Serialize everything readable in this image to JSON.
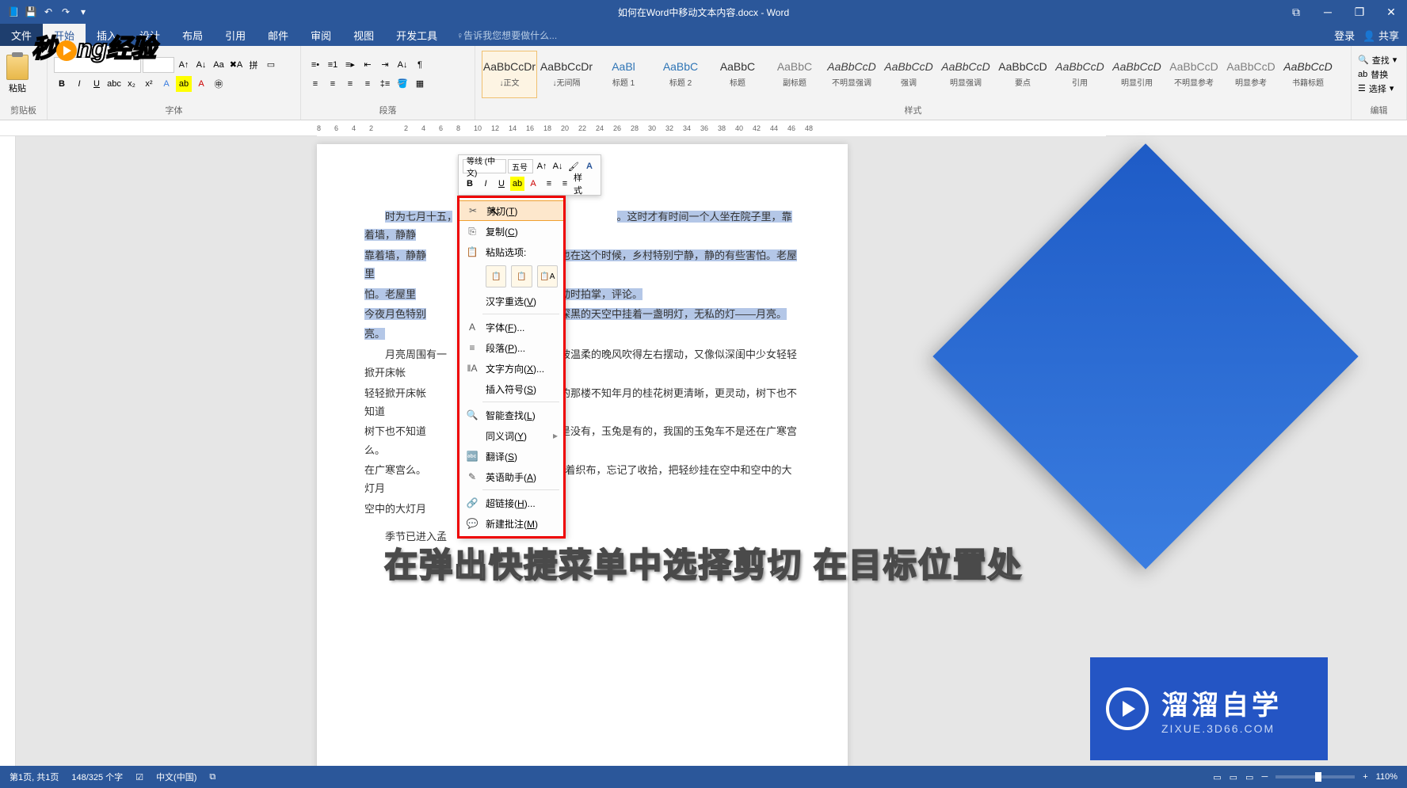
{
  "titlebar": {
    "title": "如何在Word中移动文本内容.docx - Word",
    "ribbon_display": "⧉"
  },
  "tabs": {
    "file": "文件",
    "items": [
      "开始",
      "插入",
      "设计",
      "布局",
      "引用",
      "邮件",
      "审阅",
      "视图",
      "开发工具"
    ],
    "active_index": 0,
    "tellme": "♀告诉我您想要做什么...",
    "login": "登录",
    "share": "共享"
  },
  "ribbon": {
    "clipboard": {
      "paste": "粘贴",
      "label": "剪贴板"
    },
    "font": {
      "label": "字体"
    },
    "paragraph": {
      "label": "段落"
    },
    "styles": {
      "label": "样式",
      "items": [
        {
          "preview": "AaBbCcDr",
          "name": "↓正文",
          "sel": true
        },
        {
          "preview": "AaBbCcDr",
          "name": "↓无间隔"
        },
        {
          "preview": "AaBl",
          "name": "标题 1"
        },
        {
          "preview": "AaBbC",
          "name": "标题 2"
        },
        {
          "preview": "AaBbC",
          "name": "标题"
        },
        {
          "preview": "AaBbC",
          "name": "副标题"
        },
        {
          "preview": "AaBbCcD",
          "name": "不明显强调"
        },
        {
          "preview": "AaBbCcD",
          "name": "强调"
        },
        {
          "preview": "AaBbCcD",
          "name": "明显强调"
        },
        {
          "preview": "AaBbCcD",
          "name": "要点"
        },
        {
          "preview": "AaBbCcD",
          "name": "引用"
        },
        {
          "preview": "AaBbCcD",
          "name": "明显引用"
        },
        {
          "preview": "AaBbCcD",
          "name": "不明显参考"
        },
        {
          "preview": "AaBbCcD",
          "name": "明显参考"
        },
        {
          "preview": "AaBbCcD",
          "name": "书籍标题"
        }
      ]
    },
    "editing": {
      "find": "查找",
      "replace": "替换",
      "select": "选择",
      "label": "编辑"
    }
  },
  "ruler": {
    "marks": [
      "8",
      "6",
      "4",
      "2",
      "",
      "2",
      "4",
      "6",
      "8",
      "10",
      "12",
      "14",
      "16",
      "18",
      "20",
      "22",
      "24",
      "26",
      "28",
      "30",
      "32",
      "34",
      "36",
      "38",
      "40",
      "42",
      "44",
      "46",
      "48"
    ]
  },
  "document": {
    "p1a": "时为七月十五，",
    "p1b": "群山，也在这个时候，乡村特别宁静，静的有些害怕。老屋里",
    "p1c": "偶尔激动时拍掌，评论。",
    "p2a": "今夜月色特别",
    "p2b": "了。深黑的天空中挂着一盏明灯，无私的灯——月亮。",
    "p3a": "月亮周围有一",
    "p3b": "纱被温柔的晚风吹得左右摆动，又像似深闺中少女轻轻掀开床帐",
    "p3c": "亮之上的那楼不知年月的桂花树更清晰，更灵动，树下也不知道",
    "p3d": "。吴刚是没有，玉兔是有的，我国的玉兔车不是还在广寒宫么。",
    "p3e": "女们忙碌着织布，忘记了收拾，把轻纱挂在空中和空中的大灯月",
    "p4": "季节已进入孟",
    "pre": "。这时才有时间一个人坐在院子里，靠着墙，静静"
  },
  "mini_toolbar": {
    "font_name": "等线 (中文)",
    "font_size": "五号",
    "styles_label": "样式"
  },
  "context_menu": {
    "cut": "剪切",
    "cut_key": "T",
    "copy": "复制",
    "copy_key": "C",
    "paste_options": "粘贴选项:",
    "hanzi": "汉字重选",
    "hanzi_key": "V",
    "font": "字体",
    "font_key": "F",
    "paragraph": "段落",
    "paragraph_key": "P",
    "text_dir": "文字方向",
    "text_dir_key": "X",
    "insert_symbol": "插入符号",
    "insert_symbol_key": "S",
    "smart_lookup": "智能查找",
    "smart_lookup_key": "L",
    "synonyms": "同义词",
    "synonyms_key": "Y",
    "translate": "翻译",
    "translate_key": "S",
    "english_assist": "英语助手",
    "english_assist_key": "A",
    "hyperlink": "超链接",
    "hyperlink_key": "H",
    "new_comment": "新建批注",
    "new_comment_key": "M"
  },
  "statusbar": {
    "page": "第1页, 共1页",
    "words": "148/325 个字",
    "lang_icon": "☑",
    "lang": "中文(中国)",
    "track": "⧉",
    "zoom": "110%"
  },
  "overlay": {
    "logo_a": "秒",
    "logo_b": "ng经验",
    "subtitle": "在弹出快捷菜单中选择剪切   在目标位置处",
    "bottom_brand": "溜溜自学",
    "bottom_url": "ZIXUE.3D66.COM"
  }
}
